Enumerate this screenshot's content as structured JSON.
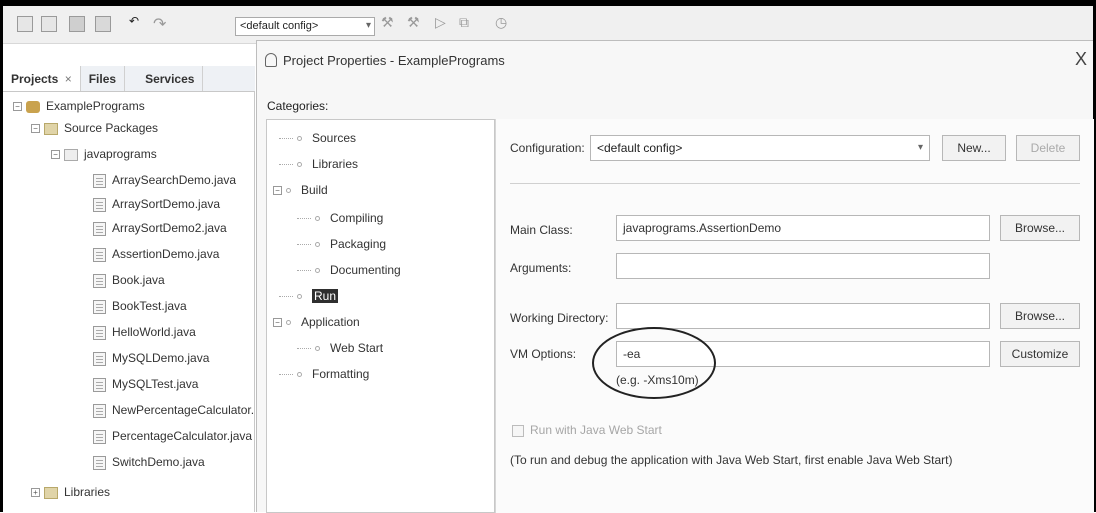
{
  "toolbar": {
    "config_value": "<default config>"
  },
  "projects_panel": {
    "tabs": [
      "Projects",
      "Files",
      "Services"
    ],
    "tab_close": "×",
    "tree": {
      "project": "ExamplePrograms",
      "source_packages": "Source Packages",
      "package": "javaprograms",
      "files": [
        "ArraySearchDemo.java",
        "ArraySortDemo.java",
        "ArraySortDemo2.java",
        "AssertionDemo.java",
        "Book.java",
        "BookTest.java",
        "HelloWorld.java",
        "MySQLDemo.java",
        "MySQLTest.java",
        "NewPercentageCalculator.",
        "PercentageCalculator.java",
        "SwitchDemo.java"
      ],
      "libraries": "Libraries"
    }
  },
  "dialog": {
    "title": "Project Properties - ExamplePrograms",
    "close": "X",
    "categories_label": "Categories:",
    "categories": {
      "sources": "Sources",
      "libraries": "Libraries",
      "build": "Build",
      "compiling": "Compiling",
      "packaging": "Packaging",
      "documenting": "Documenting",
      "run": "Run",
      "application": "Application",
      "web_start": "Web Start",
      "formatting": "Formatting"
    },
    "configuration_label": "Configuration:",
    "configuration_value": "<default config>",
    "new_button": "New...",
    "delete_button": "Delete",
    "main_class_label": "Main Class:",
    "main_class_value": "javaprograms.AssertionDemo",
    "browse_button": "Browse...",
    "arguments_label": "Arguments:",
    "arguments_value": "",
    "working_dir_label": "Working Directory:",
    "working_dir_value": "",
    "browse_button_2": "Browse...",
    "vm_options_label": "VM Options:",
    "vm_options_value": "-ea",
    "vm_options_hint": "(e.g. -Xms10m)",
    "customize_button": "Customize",
    "web_start_checkbox": "Run with Java Web Start",
    "web_start_note": "(To run and debug the application with Java Web Start, first enable Java Web Start)"
  }
}
